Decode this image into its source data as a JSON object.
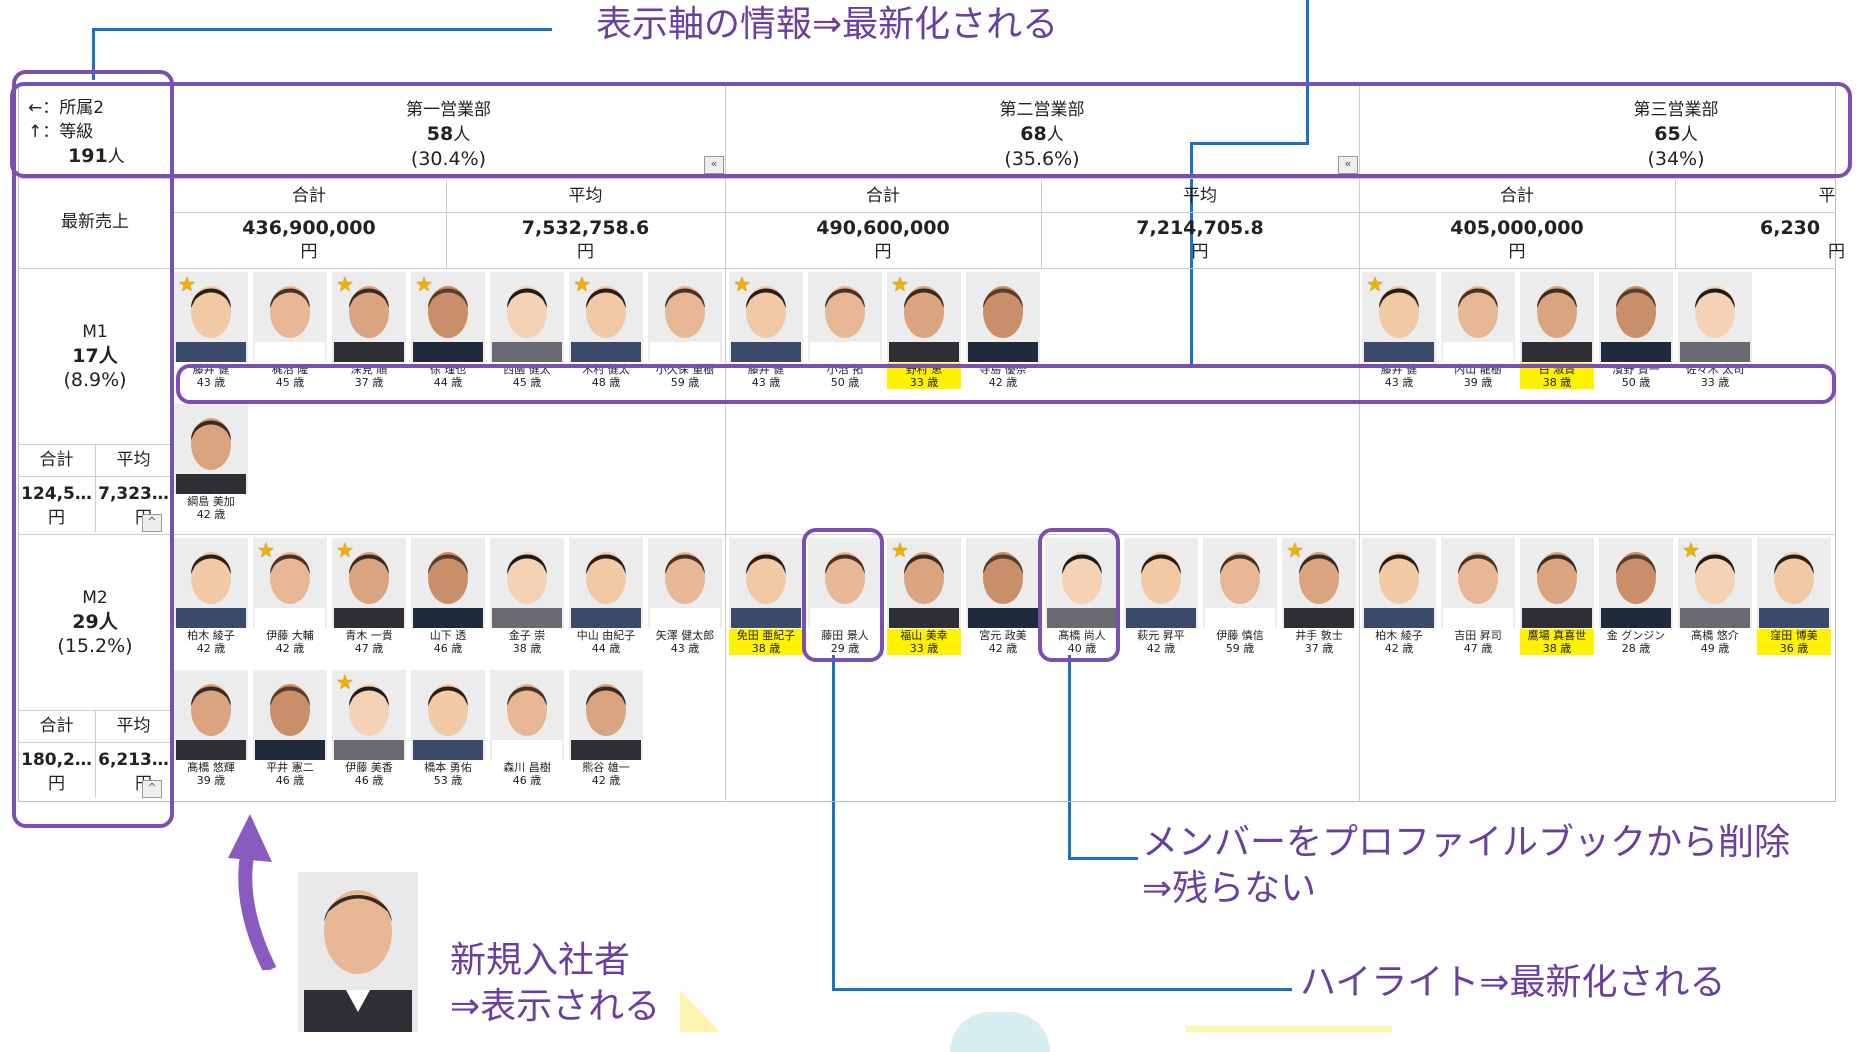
{
  "annotations": {
    "axis_note": "表示軸の情報⇒最新化される",
    "remove_note_line1": "メンバーをプロファイルブックから削除",
    "remove_note_line2": "⇒残らない",
    "highlight_note": "ハイライト⇒最新化される",
    "new_hire_line1": "新規入社者",
    "new_hire_line2": "⇒表示される"
  },
  "corner": {
    "x_axis": "←：所属2",
    "y_axis": "↑：等級",
    "total": "191",
    "total_unit": "人"
  },
  "columns": [
    {
      "name": "第一営業部",
      "count": "58",
      "unit": "人",
      "pct": "(30.4%)",
      "sum": "436,900,000",
      "sum_unit": "円",
      "avg": "7,532,758.6",
      "avg_unit": "円"
    },
    {
      "name": "第二営業部",
      "count": "68",
      "unit": "人",
      "pct": "(35.6%)",
      "sum": "490,600,000",
      "sum_unit": "円",
      "avg": "7,214,705.8",
      "avg_unit": "円"
    },
    {
      "name": "第三営業部",
      "count": "65",
      "unit": "人",
      "pct": "(34%)",
      "sum": "405,000,000",
      "sum_unit": "円",
      "avg": "6,230",
      "avg_unit": "円"
    }
  ],
  "labels": {
    "sum": "合計",
    "avg": "平均",
    "avg_cut": "平",
    "latest_sales": "最新売上",
    "collapse": "«",
    "expand": "^"
  },
  "rows": [
    {
      "name": "M1",
      "count": "17人",
      "pct": "(8.9%)",
      "sum": "124,5…",
      "avg": "7,323…",
      "sum_unit": "円",
      "avg_unit": "円"
    },
    {
      "name": "M2",
      "count": "29人",
      "pct": "(15.2%)",
      "sum": "180,2…",
      "avg": "6,213…",
      "sum_unit": "円",
      "avg_unit": "円"
    }
  ],
  "m1_d1": [
    {
      "name": "藤井 健",
      "age": "43 歳",
      "star": true,
      "hi": false
    },
    {
      "name": "梶沼 隆",
      "age": "45 歳",
      "star": false,
      "hi": false
    },
    {
      "name": "深見 順",
      "age": "37 歳",
      "star": true,
      "hi": false
    },
    {
      "name": "徐 瑾也",
      "age": "44 歳",
      "star": true,
      "hi": false
    },
    {
      "name": "西園 健太",
      "age": "45 歳",
      "star": false,
      "hi": false
    },
    {
      "name": "木村 健太",
      "age": "48 歳",
      "star": true,
      "hi": false
    },
    {
      "name": "小久保 重樹",
      "age": "59 歳",
      "star": false,
      "hi": false
    },
    {
      "name": "綱島 美加",
      "age": "42 歳",
      "star": false,
      "hi": false
    }
  ],
  "m1_d2": [
    {
      "name": "藤井 健",
      "age": "43 歳",
      "star": true,
      "hi": false
    },
    {
      "name": "小沼 拓",
      "age": "50 歳",
      "star": false,
      "hi": false
    },
    {
      "name": "野村 恵",
      "age": "33 歳",
      "star": true,
      "hi": true
    },
    {
      "name": "寺島 優奈",
      "age": "42 歳",
      "star": false,
      "hi": false
    }
  ],
  "m1_d3": [
    {
      "name": "藤井 健",
      "age": "43 歳",
      "star": true,
      "hi": false
    },
    {
      "name": "内山 龍樹",
      "age": "39 歳",
      "star": false,
      "hi": false
    },
    {
      "name": "白 淑賢",
      "age": "38 歳",
      "star": false,
      "hi": true
    },
    {
      "name": "濱野 賢一",
      "age": "50 歳",
      "star": false,
      "hi": false
    },
    {
      "name": "佐々木 太司",
      "age": "33 歳",
      "star": false,
      "hi": false
    }
  ],
  "m2_d1": [
    {
      "name": "柏木 綾子",
      "age": "42 歳",
      "star": false,
      "hi": false
    },
    {
      "name": "伊藤 大輔",
      "age": "42 歳",
      "star": true,
      "hi": false
    },
    {
      "name": "青木 一貴",
      "age": "47 歳",
      "star": true,
      "hi": false
    },
    {
      "name": "山下 透",
      "age": "46 歳",
      "star": false,
      "hi": false
    },
    {
      "name": "金子 崇",
      "age": "38 歳",
      "star": false,
      "hi": false
    },
    {
      "name": "中山 由紀子",
      "age": "44 歳",
      "star": false,
      "hi": false
    },
    {
      "name": "矢澤 健太郎",
      "age": "43 歳",
      "star": false,
      "hi": false
    },
    {
      "name": "髙橋 悠輝",
      "age": "39 歳",
      "star": false,
      "hi": false
    },
    {
      "name": "平井 憲二",
      "age": "46 歳",
      "star": false,
      "hi": false
    },
    {
      "name": "伊藤 美香",
      "age": "46 歳",
      "star": true,
      "hi": false
    },
    {
      "name": "橋本 勇佑",
      "age": "53 歳",
      "star": false,
      "hi": false
    },
    {
      "name": "森川 昌樹",
      "age": "46 歳",
      "star": false,
      "hi": false
    },
    {
      "name": "熊谷 雄一",
      "age": "42 歳",
      "star": false,
      "hi": false
    }
  ],
  "m2_d2": [
    {
      "name": "免田 亜紀子",
      "age": "38 歳",
      "star": false,
      "hi": true
    },
    {
      "name": "藤田 景人",
      "age": "29 歳",
      "star": false,
      "hi": false
    },
    {
      "name": "福山 美幸",
      "age": "33 歳",
      "star": true,
      "hi": true
    },
    {
      "name": "宮元 政美",
      "age": "42 歳",
      "star": false,
      "hi": false
    },
    {
      "name": "髙橋 尚人",
      "age": "40 歳",
      "star": false,
      "hi": false
    },
    {
      "name": "萩元 昇平",
      "age": "42 歳",
      "star": false,
      "hi": false
    },
    {
      "name": "伊藤 慎信",
      "age": "59 歳",
      "star": false,
      "hi": false
    },
    {
      "name": "井手 敦士",
      "age": "37 歳",
      "star": true,
      "hi": false
    }
  ],
  "m2_d3": [
    {
      "name": "柏木 綾子",
      "age": "42 歳",
      "star": false,
      "hi": false
    },
    {
      "name": "吉田 昇司",
      "age": "47 歳",
      "star": false,
      "hi": false
    },
    {
      "name": "鷹場 真喜世",
      "age": "38 歳",
      "star": false,
      "hi": true
    },
    {
      "name": "金 グンジン",
      "age": "28 歳",
      "star": false,
      "hi": false
    },
    {
      "name": "髙橋 悠介",
      "age": "49 歳",
      "star": true,
      "hi": false
    },
    {
      "name": "窪田 博美",
      "age": "36 歳",
      "star": false,
      "hi": true
    }
  ],
  "colors": {
    "accent_purple": "#7a4fb0",
    "line_blue": "#1a73c2",
    "highlight_yellow": "#fff200",
    "star_gold": "#f0b000"
  },
  "icons": {
    "star": "star-icon",
    "collapse": "double-chevron-left-icon",
    "expand": "chevron-up-icon",
    "new_hire_arrow": "curved-arrow-up-icon"
  }
}
